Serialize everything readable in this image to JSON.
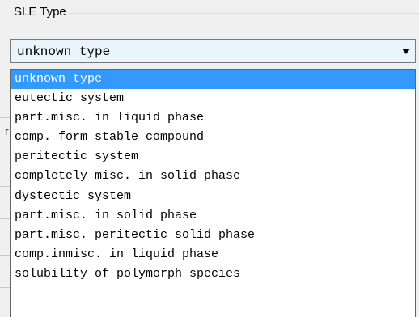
{
  "group": {
    "title": "SLE Type"
  },
  "combo": {
    "value": "unknown type"
  },
  "background": {
    "partial_char": "r"
  },
  "dropdown": {
    "selected_index": 0,
    "options": [
      "unknown type",
      "eutectic system",
      "part.misc. in liquid phase",
      "comp. form stable compound",
      "peritectic system",
      "completely misc. in solid phase",
      "dystectic system",
      "part.misc. in solid phase",
      "part.misc. peritectic solid phase",
      "comp.inmisc. in liquid phase",
      "solubility of polymorph species"
    ]
  },
  "colors": {
    "selection": "#3399ff",
    "combo_bg": "#eaf4fb"
  }
}
